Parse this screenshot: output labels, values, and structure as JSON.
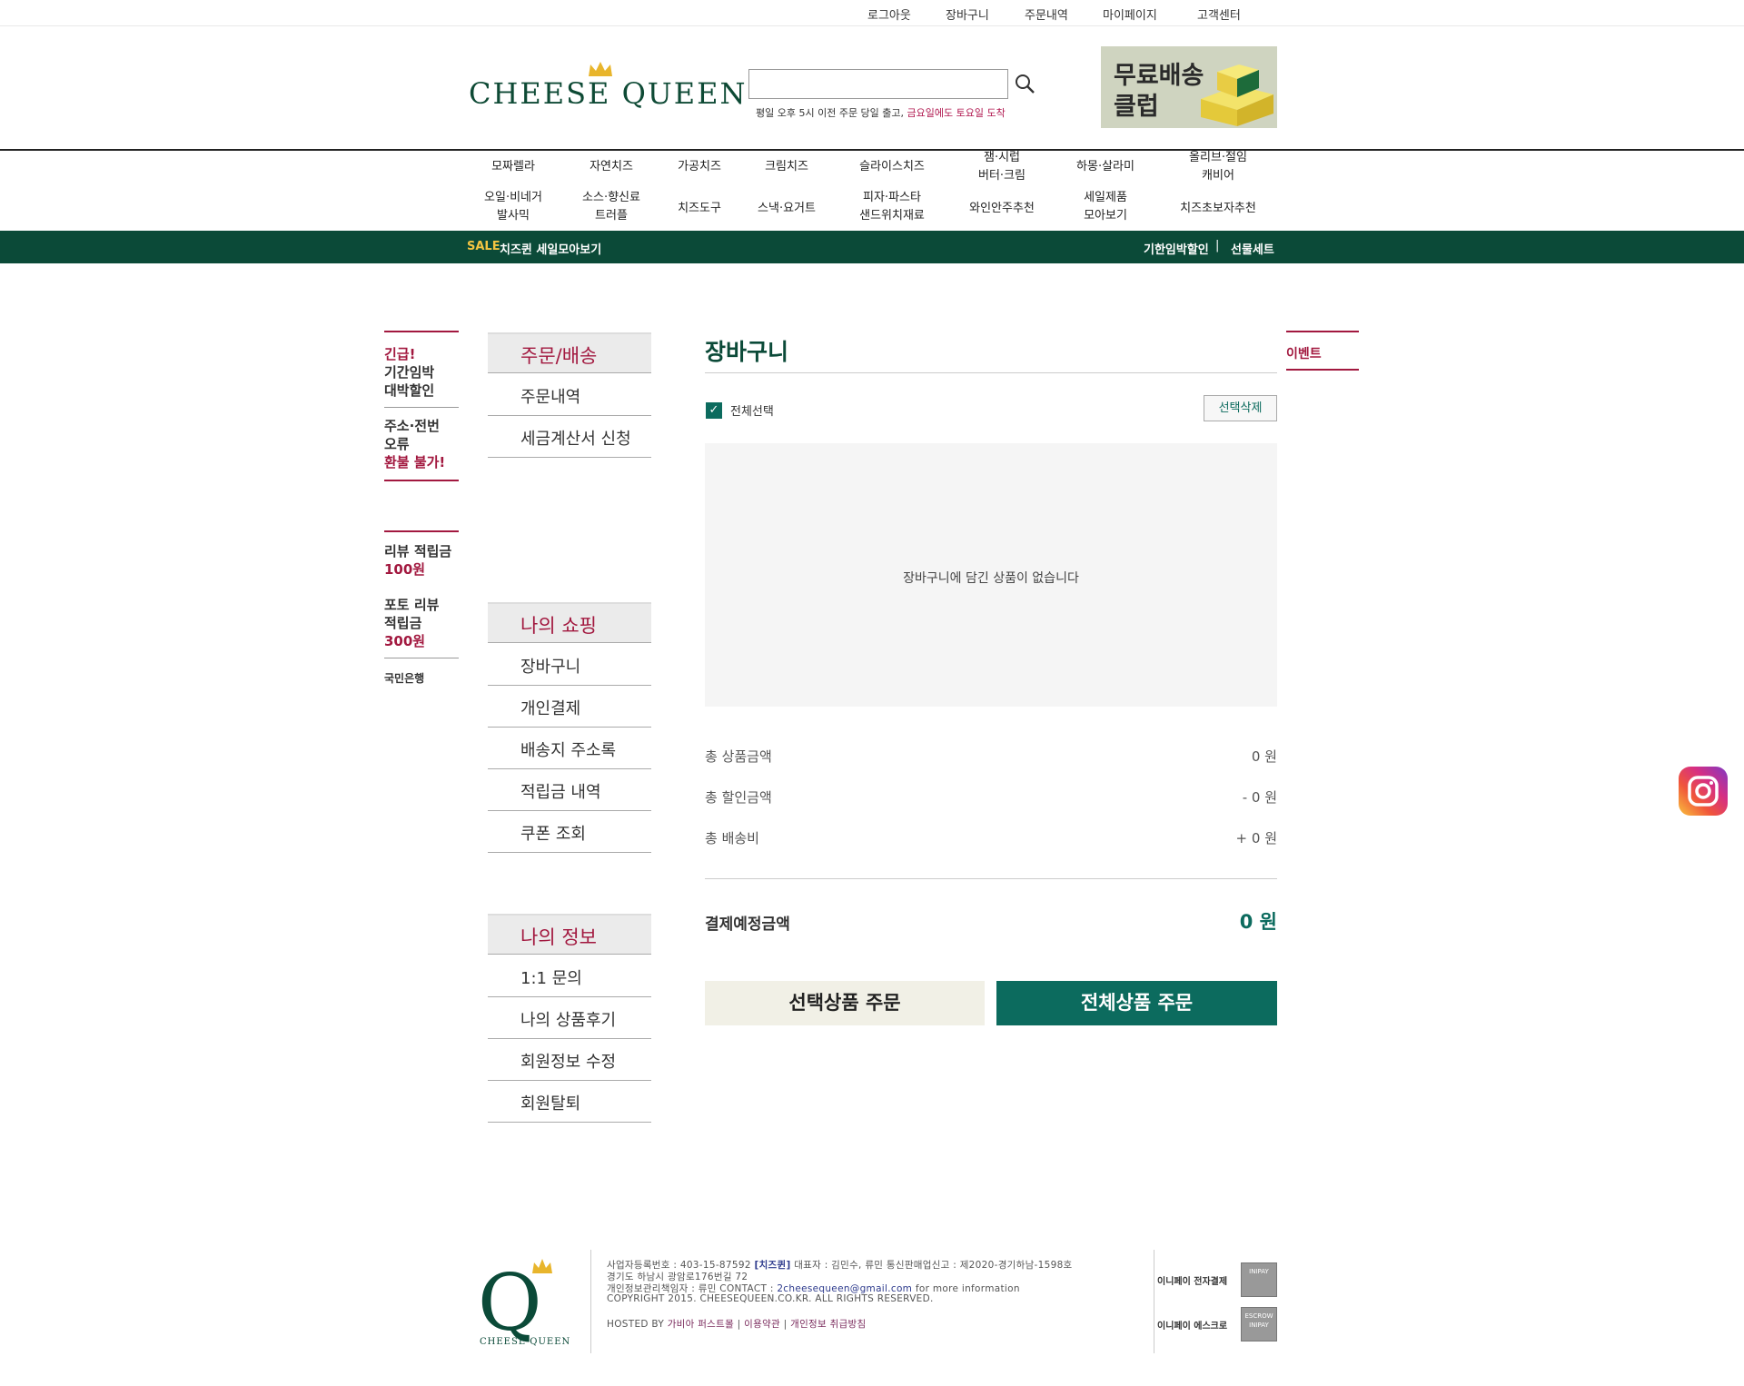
{
  "top_links": [
    "로그아웃",
    "장바구니",
    "주문내역",
    "마이페이지",
    "고객센터"
  ],
  "header": {
    "logo_text": "CHEESE QUEEN",
    "search_placeholder": "",
    "notice_prefix": "평일 오후 5시 이전 주문 당일 출고, ",
    "notice_highlight": "금요일에도 토요일 도착",
    "banner_line1": "무료배송",
    "banner_line2": "클럽"
  },
  "gnb_row1": [
    "모짜렐라",
    "자연치즈",
    "가공치즈",
    "크림치즈",
    "슬라이스치즈",
    "잼·시럽\n버터·크림",
    "하몽·살라미",
    "올리브·절임\n캐비어"
  ],
  "gnb_row2": [
    "오일·비네거\n발사믹",
    "소스·향신료\n트러플",
    "치즈도구",
    "스낵·요거트",
    "피자·파스타\n샌드위치재료",
    "와인안주추천",
    "세일제품\n모아보기",
    "치즈초보자추천"
  ],
  "subbar": {
    "sale": "SALE",
    "sale_label": "치즈퀸 세일모아보기",
    "right1": "기한임박할인",
    "separator": "|",
    "right2": "선물세트"
  },
  "left_notices": [
    {
      "red": "긴급!",
      "text": "기간임박\n대박할인",
      "red_after": ""
    },
    {
      "red": "",
      "text": "주소·전번\n오류",
      "red_after": "환불 불가!"
    },
    {
      "red": "",
      "text": "리뷰 적립금",
      "red_after": "100원"
    },
    {
      "red": "",
      "text": "포토 리뷰\n적립금",
      "red_after": "300원"
    },
    {
      "red": "",
      "text": "국민은행",
      "red_after": ""
    }
  ],
  "menu": {
    "order_head": "주문/배송",
    "order_items": [
      "주문내역",
      "세금계산서 신청"
    ],
    "shop_head": "나의 쇼핑",
    "shop_items": [
      "장바구니",
      "개인결제",
      "배송지 주소록",
      "적립금 내역",
      "쿠폰 조회"
    ],
    "info_head": "나의 정보",
    "info_items": [
      "1:1 문의",
      "나의 상품후기",
      "회원정보 수정",
      "회원탈퇴"
    ]
  },
  "cart": {
    "title": "장바구니",
    "select_all": "전체선택",
    "select_all_checked": true,
    "delete_selected": "선택삭제",
    "empty_message": "장바구니에 담긴 상품이 없습니다",
    "summary": [
      {
        "label": "총 상품금액",
        "value": "0 원"
      },
      {
        "label": "총 할인금액",
        "value": "- 0 원"
      },
      {
        "label": "총 배송비",
        "value": "+ 0 원"
      }
    ],
    "pay_label": "결제예정금액",
    "pay_value": "0 원",
    "btn_order_selected": "선택상품 주문",
    "btn_order_all": "전체상품 주문"
  },
  "right": {
    "event": "이벤트"
  },
  "footer": {
    "line1_a": "사업자등록번호 : 403-15-87592",
    "line1_b": "[치즈퀸]",
    "line1_c": "대표자 : 김민수, 류민 통신판매업신고 : 제2020-경기하남-1598호",
    "line2": "경기도 하남시 광암로176번길 72",
    "line3_a": "개인정보관리책임자 : 류민 CONTACT : ",
    "line3_email": "2cheesequeen@gmail.com",
    "line3_b": " for more information",
    "line4": "COPYRIGHT 2015. CHEESEQUEEN.CO.KR. ALL RIGHTS RESERVED.",
    "line5_a": "HOSTED BY ",
    "line5_host": "가비아 퍼스트몰",
    "line5_sep": " | ",
    "line5_terms": "이용약관",
    "line5_privacy": "개인정보 취급방침",
    "pay1": "이니페이 전자결제",
    "pay2": "이니페이 에스크로",
    "badge1": "INIPAY",
    "badge2": "ESCROW INIPAY",
    "logo_q": "Q",
    "logo_text": "CHEESE QUEEN"
  },
  "colors": {
    "brand_green": "#0b4a38",
    "accent_teal": "#0c6b5e",
    "accent_red": "#a2183f"
  }
}
